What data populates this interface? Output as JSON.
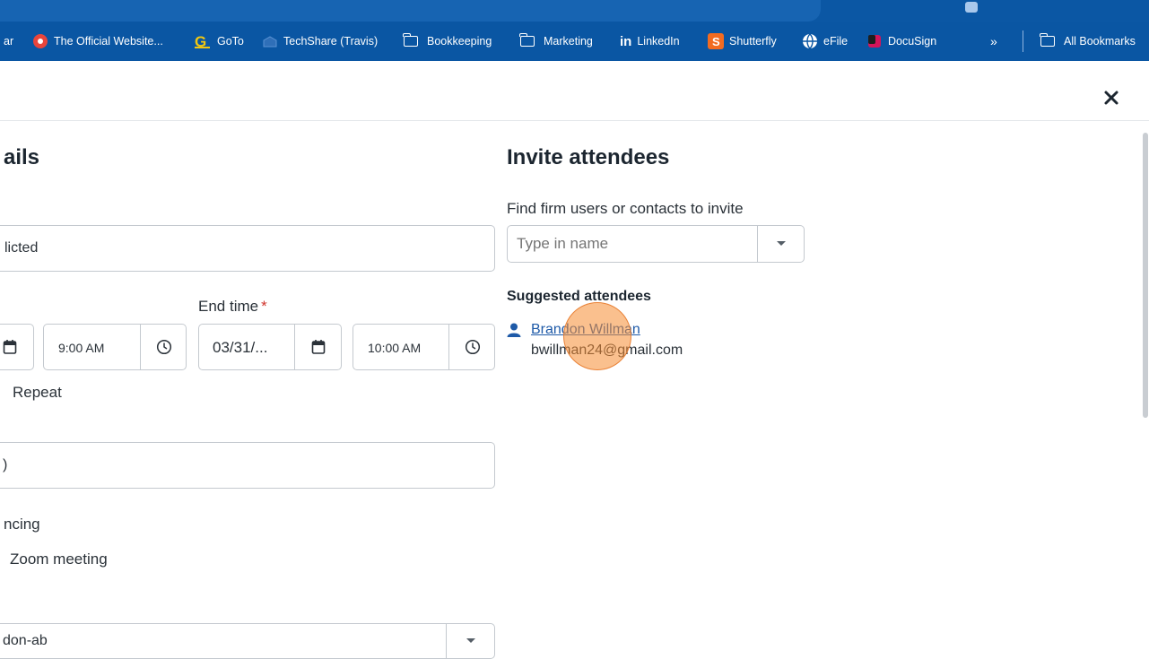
{
  "bookmarks": [
    {
      "label": "ar",
      "icon": "truncated"
    },
    {
      "label": "The Official Website...",
      "icon": "red-circle-icon"
    },
    {
      "label": "GoTo",
      "icon": "goto-logo-icon"
    },
    {
      "label": "TechShare (Travis)",
      "icon": "building-icon"
    },
    {
      "label": "Bookkeeping",
      "icon": "folder-icon"
    },
    {
      "label": "Marketing",
      "icon": "folder-icon"
    },
    {
      "label": "LinkedIn",
      "icon": "linkedin-icon"
    },
    {
      "label": "Shutterfly",
      "icon": "shutterfly-icon"
    },
    {
      "label": "eFile",
      "icon": "globe-icon"
    },
    {
      "label": "DocuSign",
      "icon": "docusign-icon"
    }
  ],
  "bookmarks_overflow": "»",
  "all_bookmarks": "All Bookmarks",
  "left": {
    "section_title_partial": "ails",
    "title_value_partial": "licted",
    "end_time_label": "End time",
    "required_mark": "*",
    "start_time": "9:00 AM",
    "end_date": "03/31/...",
    "end_time": "10:00 AM",
    "repeat_label": "Repeat",
    "location_value_partial": ")",
    "conferencing_label_partial": "ncing",
    "zoom_label": "Zoom meeting",
    "calendar_value_partial": "don-ab"
  },
  "right": {
    "section_title": "Invite attendees",
    "find_label": "Find firm users or contacts to invite",
    "find_placeholder": "Type in name",
    "suggested_title": "Suggested attendees",
    "attendee_name": "Brandon Willman",
    "attendee_email": "bwillman24@gmail.com"
  },
  "colors": {
    "browser_bar": "#0a56a3",
    "link": "#1e5aa8",
    "required": "#d0342c",
    "click_highlight": "#f58c32"
  }
}
